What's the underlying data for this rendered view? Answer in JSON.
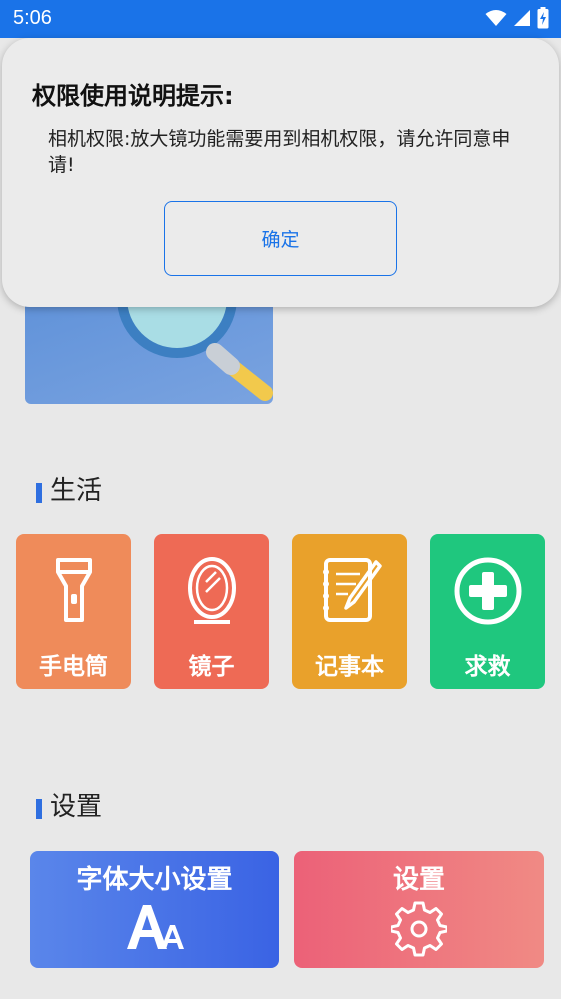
{
  "status_bar": {
    "time": "5:06",
    "icons": [
      "wifi-icon",
      "signal-icon",
      "battery-charging-icon"
    ]
  },
  "dialog": {
    "title": "权限使用说明提示:",
    "message": "相机权限:放大镜功能需要用到相机权限，请允许同意申请!",
    "confirm_label": "确定"
  },
  "life_section": {
    "title": "生活",
    "tiles": [
      {
        "label": "手电筒",
        "icon": "flashlight-icon",
        "color": "#ef8b5a"
      },
      {
        "label": "镜子",
        "icon": "mirror-icon",
        "color": "#ee6a55"
      },
      {
        "label": "记事本",
        "icon": "notepad-icon",
        "color": "#e9a12b"
      },
      {
        "label": "求救",
        "icon": "plus-circle-icon",
        "color": "#1fc77e"
      }
    ]
  },
  "settings_section": {
    "title": "设置",
    "font_tile": {
      "label": "字体大小设置",
      "icon": "font-size-icon",
      "color_start": "#5a86ea",
      "color_end": "#3a63e4"
    },
    "settings_tile": {
      "label": "设置",
      "icon": "gear-icon",
      "color_start": "#ec6178",
      "color_end": "#f08a84"
    }
  }
}
